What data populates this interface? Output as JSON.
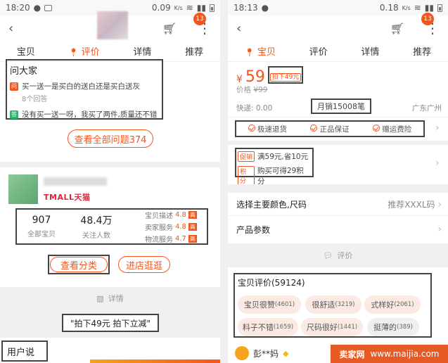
{
  "left": {
    "status": {
      "time": "18:20",
      "speed": "0.09",
      "speed_unit": "K/s"
    },
    "badge": "13",
    "tabs": [
      "宝贝",
      "评价",
      "详情",
      "推荐"
    ],
    "qa": {
      "title": "问大家",
      "question": "买一送一是买白的送白还是买白送灰",
      "answers_count": "8个回答",
      "answer": "没有买一送一呀，我买了两件,质量还不错",
      "q_tag": "问",
      "a_tag": "答"
    },
    "all_questions_btn": "查看全部问题374",
    "store": {
      "tmall": "TMALL天猫",
      "total_items": "907",
      "total_items_label": "全部宝贝",
      "followers": "48.4万",
      "followers_label": "关注人数",
      "scores": [
        {
          "label": "宝贝描述",
          "value": "4.8",
          "tag": "高"
        },
        {
          "label": "卖家服务",
          "value": "4.8",
          "tag": "高"
        },
        {
          "label": "物流服务",
          "value": "4.7",
          "tag": "高"
        }
      ]
    },
    "category_btn": "查看分类",
    "visit_btn": "进店逛逛",
    "detail_label": "详情",
    "promo_text": "\"拍下49元 拍下立减\"",
    "user_says": "用户说"
  },
  "right": {
    "status": {
      "time": "18:13",
      "speed": "0.18",
      "speed_unit": "K/s"
    },
    "badge": "13",
    "tabs": [
      "宝贝",
      "评价",
      "详情",
      "推荐"
    ],
    "price_symbol": "¥",
    "price": "59",
    "price_tag": "拍下49元",
    "orig_label": "价格",
    "orig_price": "¥99",
    "shipping": "快递: 0.00",
    "monthly_sales": "月销15008笔",
    "location": "广东广州",
    "services": [
      "极速退货",
      "正品保证",
      "赠运费险"
    ],
    "promo1_tag": "促销",
    "promo1": "满59元,省10元",
    "promo2_tag": "积分",
    "promo2": "购买可得29积分",
    "select_label": "选择主要颜色,尺码",
    "select_value": "推荐XXXL码",
    "params_label": "产品参数",
    "review_divider": "评价",
    "review_title": "宝贝评价(59124)",
    "review_tags": [
      {
        "label": "宝贝很赞",
        "count": "(4601)"
      },
      {
        "label": "很舒适",
        "count": "(3219)"
      },
      {
        "label": "式样好",
        "count": "(2061)"
      },
      {
        "label": "料子不错",
        "count": "(1659)"
      },
      {
        "label": "尺码很好",
        "count": "(1441)"
      },
      {
        "label": "挺薄的",
        "count": "(389)"
      }
    ],
    "reviewer": "彭**妈"
  },
  "watermark": {
    "brand": "卖家网",
    "url": "www.maijia.com"
  },
  "colors": {
    "accent": "#f5541b",
    "tmall": "#e0253f"
  }
}
